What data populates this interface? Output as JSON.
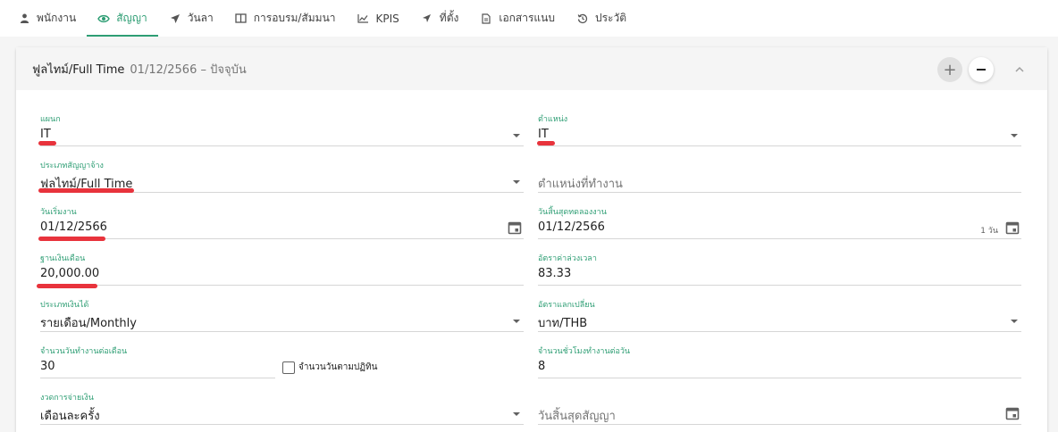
{
  "tabs": [
    {
      "label": "พนักงาน",
      "icon": "person-icon"
    },
    {
      "label": "สัญญา",
      "icon": "eye-icon"
    },
    {
      "label": "วันลา",
      "icon": "plane-icon"
    },
    {
      "label": "การอบรม/สัมมนา",
      "icon": "book-icon"
    },
    {
      "label": "KPIS",
      "icon": "chart-icon"
    },
    {
      "label": "ที่ตั้ง",
      "icon": "location-icon"
    },
    {
      "label": "เอกสารแนบ",
      "icon": "attachment-icon"
    },
    {
      "label": "ประวัติ",
      "icon": "history-icon"
    }
  ],
  "active_tab_index": 1,
  "colors": {
    "accent": "#2e9e74",
    "highlight": "#e8333c"
  },
  "contract": {
    "title": "ฟูลไทม์/Full Time",
    "range": "01/12/2566 – ปัจจุบัน",
    "add_label": "+"
  },
  "fields": {
    "department": {
      "label": "แผนก",
      "value": "IT"
    },
    "position": {
      "label": "ตำแหน่ง",
      "value": "IT"
    },
    "contract_type": {
      "label": "ประเภทสัญญาจ้าง",
      "value": "ฟูลไทม์/Full Time"
    },
    "work_position": {
      "placeholder": "ตำแหน่งที่ทำงาน"
    },
    "start_date": {
      "label": "วันเริ่มงาน",
      "value": "01/12/2566"
    },
    "probation_end": {
      "label": "วันสิ้นสุดทดลองงาน",
      "value": "01/12/2566",
      "days": "1 วัน"
    },
    "base_salary": {
      "label": "ฐานเงินเดือน",
      "value": "20,000.00"
    },
    "overtime_rate": {
      "label": "อัตราค่าล่วงเวลา",
      "value": "83.33"
    },
    "pay_type": {
      "label": "ประเภทเงินได้",
      "value": "รายเดือน/Monthly"
    },
    "exchange_rate": {
      "label": "อัตราแลกเปลี่ยน",
      "value": "บาท/THB"
    },
    "workdays_per_month": {
      "label": "จำนวนวันทำงานต่อเดือน",
      "value": "30"
    },
    "calendar_days_checkbox": {
      "label": "จำนวนวันตามปฏิทิน"
    },
    "hours_per_day": {
      "label": "จำนวนชั่วโมงทำงานต่อวัน",
      "value": "8"
    },
    "pay_period": {
      "label": "งวดการจ่ายเงิน",
      "value": "เดือนละครั้ง"
    },
    "contract_end": {
      "placeholder": "วันสิ้นสุดสัญญา"
    }
  }
}
